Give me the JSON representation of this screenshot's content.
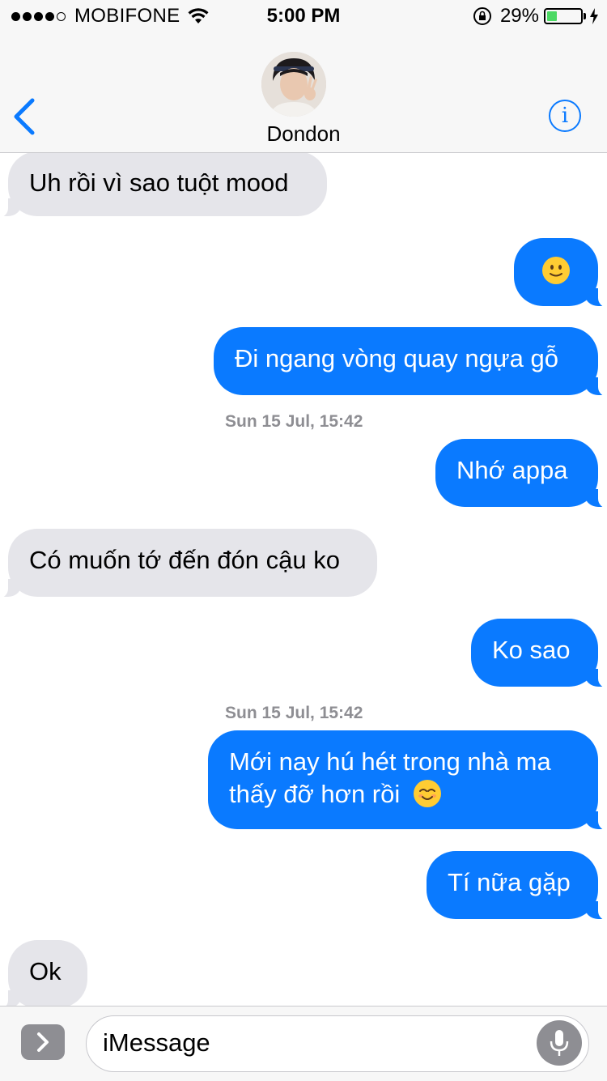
{
  "status_bar": {
    "carrier": "MOBIFONE",
    "time": "5:00 PM",
    "battery_percent_label": "29%",
    "battery_level": 0.29,
    "signal_bars_filled": 4,
    "signal_bars_total": 5
  },
  "header": {
    "contact_name": "Dondon",
    "back_icon": "chevron-left-icon",
    "info_icon": "info-icon",
    "info_glyph": "i"
  },
  "messages": [
    {
      "direction": "incoming",
      "text": "Uh rồi vì sao tuột mood"
    },
    {
      "direction": "outgoing",
      "text": "🙂"
    },
    {
      "direction": "outgoing",
      "text": "Đi ngang vòng quay ngựa gỗ"
    },
    {
      "type": "timestamp",
      "text": "Sun 15 Jul, 15:42"
    },
    {
      "direction": "outgoing",
      "text": "Nhớ appa"
    },
    {
      "direction": "incoming",
      "text": "Có muốn tớ đến đón cậu ko"
    },
    {
      "direction": "outgoing",
      "text": "Ko sao"
    },
    {
      "type": "timestamp",
      "text": "Sun 15 Jul, 15:42"
    },
    {
      "direction": "outgoing",
      "text_line1": "Mới nay hú hét trong nhà ma",
      "text_line2": "thấy đỡ hơn rồi",
      "emoji": "😊"
    },
    {
      "direction": "outgoing",
      "text": "Tí nữa gặp"
    },
    {
      "direction": "incoming",
      "text": "Ok"
    }
  ],
  "input_bar": {
    "expand_glyph": "›",
    "placeholder": "iMessage",
    "mic_icon": "microphone-icon"
  },
  "colors": {
    "accent": "#0a7aff",
    "incoming_bubble": "#e5e5ea",
    "timestamp": "#8e8e93",
    "battery": "#4cd964"
  }
}
